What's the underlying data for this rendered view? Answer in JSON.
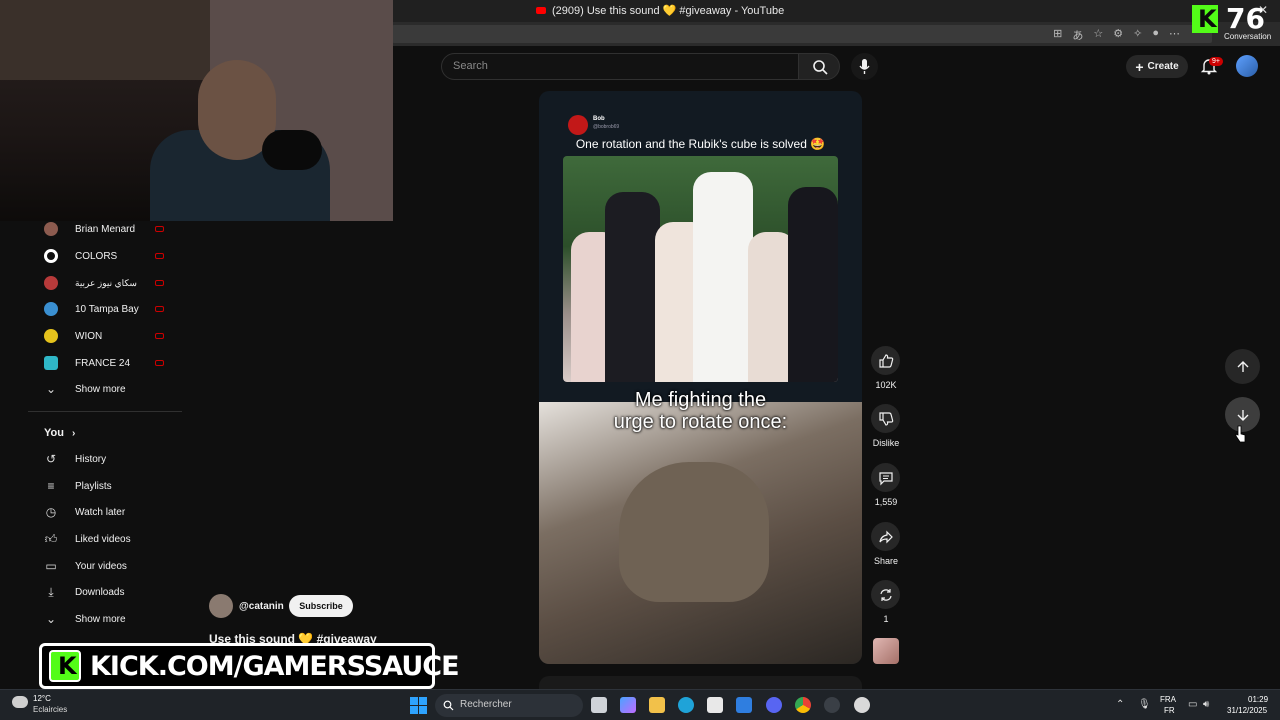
{
  "browser": {
    "tab_title": "(2909) Use this sound 💛 #giveaway - YouTube"
  },
  "header": {
    "search_placeholder": "Search",
    "create_label": "Create",
    "notification_badge": "9+"
  },
  "kick_overlay": {
    "count": "76",
    "label": "Conversation",
    "banner_text": "KICK.COM/GAMERSSAUCE"
  },
  "sidebar": {
    "subscriptions": [
      {
        "label": "Brian Menard",
        "color": "#8c5b4f"
      },
      {
        "label": "COLORS",
        "color": "#ffffff"
      },
      {
        "label": "سكاي نيوز عربية",
        "color": "#b73a3a"
      },
      {
        "label": "10 Tampa Bay",
        "color": "#3a8fd1"
      },
      {
        "label": "WION",
        "color": "#e5c21c"
      },
      {
        "label": "FRANCE 24",
        "color": "#2fb7c7"
      }
    ],
    "show_more": "Show more",
    "you_label": "You",
    "you_items": [
      {
        "label": "History",
        "icon": "history-icon"
      },
      {
        "label": "Playlists",
        "icon": "playlists-icon"
      },
      {
        "label": "Watch later",
        "icon": "clock-icon"
      },
      {
        "label": "Liked videos",
        "icon": "thumb-up-icon"
      },
      {
        "label": "Your videos",
        "icon": "video-icon"
      },
      {
        "label": "Downloads",
        "icon": "download-icon"
      }
    ],
    "show_more_2": "Show more"
  },
  "short": {
    "tweet_name": "Bob",
    "tweet_handle": "@bobrob69",
    "tweet_text": "One rotation and the Rubik's cube is solved 🤩",
    "caption_line1": "Me fighting the",
    "caption_line2": "urge to rotate once:",
    "channel": "@catanin",
    "subscribe_label": "Subscribe",
    "title": "Use this sound 💛 #giveaway"
  },
  "actions": {
    "likes": "102K",
    "dislike_label": "Dislike",
    "comments": "1,559",
    "share_label": "Share",
    "remix": "1"
  },
  "taskbar": {
    "temperature": "12°C",
    "condition": "Eclaircies",
    "search_placeholder": "Rechercher",
    "lang_line1": "FRA",
    "lang_line2": "FR",
    "time": "01:29",
    "date": "31/12/2025"
  },
  "colors": {
    "background": "#0f0f0f",
    "kick_green": "#53fc18",
    "youtube_red": "#ff0000"
  }
}
